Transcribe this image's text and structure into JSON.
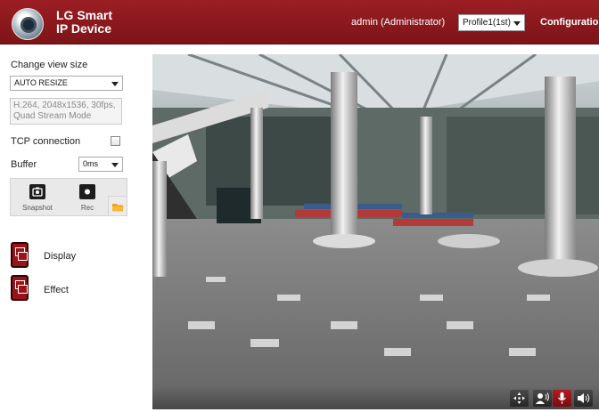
{
  "header": {
    "brand_line1": "LG Smart",
    "brand_line2": "IP Device",
    "user": "admin (Administrator)",
    "profile_selected": "Profile1(1st)",
    "configuration_label": "Configuration"
  },
  "sidebar": {
    "view_size_label": "Change view size",
    "view_size_value": "AUTO RESIZE",
    "stream_info_line1": "H.264, 2048x1536, 30fps,",
    "stream_info_line2": "Quad Stream Mode",
    "tcp_label": "TCP connection",
    "tcp_checked": false,
    "buffer_label": "Buffer",
    "buffer_value": "0ms",
    "snapshot_label": "Snapshot",
    "rec_label": "Rec",
    "display_label": "Display",
    "effect_label": "Effect"
  },
  "colors": {
    "header_bg": "#8a1a1f",
    "accent_red": "#9a1318"
  }
}
